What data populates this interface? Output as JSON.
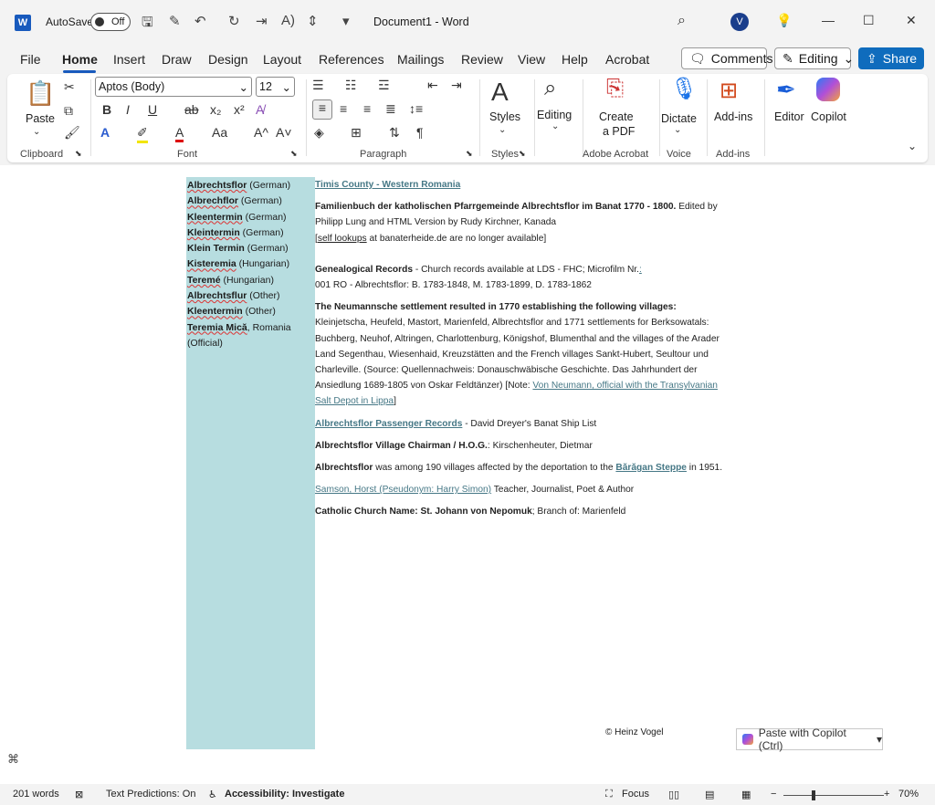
{
  "titlebar": {
    "app_icon": "W",
    "autosave_label": "AutoSave",
    "autosave_state": "Off",
    "doc_title": "Document1  -  Word"
  },
  "tabs": [
    "File",
    "Home",
    "Insert",
    "Draw",
    "Design",
    "Layout",
    "References",
    "Mailings",
    "Review",
    "View",
    "Help",
    "Acrobat"
  ],
  "right_buttons": {
    "comments": "Comments",
    "editing": "Editing",
    "share": "Share"
  },
  "ribbon": {
    "clipboard": {
      "paste": "Paste",
      "label": "Clipboard"
    },
    "font": {
      "family": "Aptos (Body)",
      "size": "12",
      "label": "Font"
    },
    "paragraph": {
      "label": "Paragraph"
    },
    "styles": {
      "btn": "Styles",
      "label": "Styles"
    },
    "editing": {
      "btn": "Editing"
    },
    "acrobat": {
      "btn1": "Create",
      "btn2": "a PDF",
      "label": "Adobe Acrobat"
    },
    "voice": {
      "btn": "Dictate",
      "label": "Voice"
    },
    "addins": {
      "btn": "Add-ins",
      "label": "Add-ins"
    },
    "editor": {
      "btn": "Editor"
    },
    "copilot": {
      "btn": "Copilot"
    }
  },
  "left_names": [
    {
      "name": "Albrechtsflor",
      "lang": " (German)"
    },
    {
      "name": "Albrechflor",
      "lang": " (German)"
    },
    {
      "name": "Kleentermin",
      "lang": " (German)"
    },
    {
      "name": "Kleintermin",
      "lang": " (German)"
    },
    {
      "name": "Klein Termin",
      "lang": " (German)"
    },
    {
      "name": "Kisteremia",
      "lang": " (Hungarian)"
    },
    {
      "name": "Teremé",
      "lang": " (Hungarian)"
    },
    {
      "name": "Albrechtsflur",
      "lang": " (Other)"
    },
    {
      "name": "Kleentermin",
      "lang": " (Other)"
    },
    {
      "name": "Teremia Mică",
      "lang": ", Romania (Official)"
    }
  ],
  "content": {
    "county_link": "Timis County - Western Romania",
    "family_book_bold": "Familienbuch der katholischen Pfarrgemeinde Albrechtsflor im Banat 1770 - 1800.",
    "family_book_rest": " Edited by Philipp Lung and HTML Version by Rudy Kirchner, Kanada",
    "self_lookups_link": "self lookups",
    "self_lookups_rest": " at banaterheide.de are no longer available]",
    "genealogical_bold": "Genealogical Records",
    "genealogical_rest": " - Church records available at LDS - FHC; Microfilm Nr.",
    "genealogical_link": ":",
    "genealogical_line2": "001 RO - Albrechtsflor: B. 1783-1848, M. 1783-1899, D. 1783-1862",
    "neumann_bold": "The Neumannsche settlement resulted in 1770 establishing the following villages:",
    "neumann_rest": " Kleinjetscha, Heufeld, Mastort, Marienfeld, Albrechtsflor and 1771 settlements for Berksowatals: Buchberg, Neuhof, Altringen, Charlottenburg, Königshof, Blumenthal and the villages of the Arader Land Segenthau, Wiesenhaid, Kreuzstätten and the French villages Sankt-Hubert, Seultour und Charleville. (Source: Quellennachweis: Donauschwäbische Geschichte. Das Jahrhundert der Ansiedlung 1689-1805 von Oskar Feldtänzer) [Note: ",
    "neumann_link": "Von Neumann, official with the Transylvanian Salt Depot in Lippa",
    "neumann_end": "]",
    "passenger_link": "Albrechtsflor Passenger Records",
    "passenger_rest": " - David Dreyer's Banat Ship List",
    "chairman_bold": "Albrechtsflor Village Chairman / H.O.G.",
    "chairman_rest": ": Kirschenheuter, Dietmar",
    "deport_bold": "Albrechtsflor",
    "deport_rest": " was among 190 villages affected by the deportation to the ",
    "deport_link": "Bărăgan Steppe",
    "deport_end": " in 1951.",
    "samson_link": "Samson, Horst (Pseudonym: Harry Simon)",
    "samson_rest": " Teacher, Journalist, Poet & Author",
    "church_bold": "Catholic Church Name: St. Johann von Nepomuk",
    "church_rest": "; Branch of: Marienfeld",
    "copyright": "© Heinz Vogel",
    "paste_copilot": "Paste with Copilot (Ctrl)"
  },
  "status": {
    "words": "201 words",
    "predictions": "Text Predictions: On",
    "accessibility": "Accessibility: Investigate",
    "focus": "Focus",
    "zoom": "70%"
  },
  "icons": [
    "word-app-icon",
    "save-icon",
    "undo-icon",
    "redo-icon",
    "search-icon",
    "lightbulb-icon",
    "minimize-icon",
    "maximize-icon",
    "close-icon",
    "clipboard-icon",
    "cut-icon",
    "copy-icon",
    "format-painter-icon",
    "bold-icon",
    "italic-icon",
    "underline-icon",
    "strikethrough-icon",
    "subscript-icon",
    "superscript-icon",
    "bullets-icon",
    "numbering-icon",
    "align-left-icon",
    "styles-icon",
    "editing-icon",
    "pdf-icon",
    "microphone-icon",
    "addins-icon",
    "editor-icon",
    "copilot-icon",
    "focus-icon",
    "read-mode-icon",
    "print-layout-icon",
    "web-layout-icon"
  ]
}
